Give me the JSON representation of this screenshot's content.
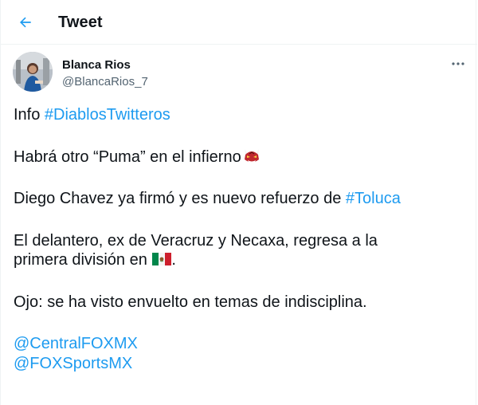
{
  "header": {
    "title": "Tweet",
    "back_icon": "arrow-left-icon",
    "accent": "#1d9bf0"
  },
  "author": {
    "name": "Blanca Rios",
    "handle": "@BlancaRios_7",
    "more_icon": "more-horizontal-icon"
  },
  "tweet": {
    "line1_prefix": "Info ",
    "hashtag1": "#DiablosTwitteros",
    "line2": "Habrá otro “Puma” en el infierno",
    "line2_emoji": "ogre-emoji",
    "line3_prefix": "Diego Chavez ya firmó y es nuevo refuerzo de ",
    "hashtag2": "#Toluca",
    "line4a": "El delantero, ex de Veracruz y Necaxa, regresa a la",
    "line4b_prefix": "primera división en ",
    "line4b_emoji": "mexico-flag-emoji",
    "line4b_suffix": ".",
    "line5": "Ojo: se ha visto envuelto en temas de indisciplina.",
    "mention1": "@CentralFOXMX",
    "mention2": "@FOXSportsMX"
  },
  "colors": {
    "text": "#0f1419",
    "secondary": "#536471",
    "link": "#1d9bf0",
    "border": "#eff3f4"
  }
}
